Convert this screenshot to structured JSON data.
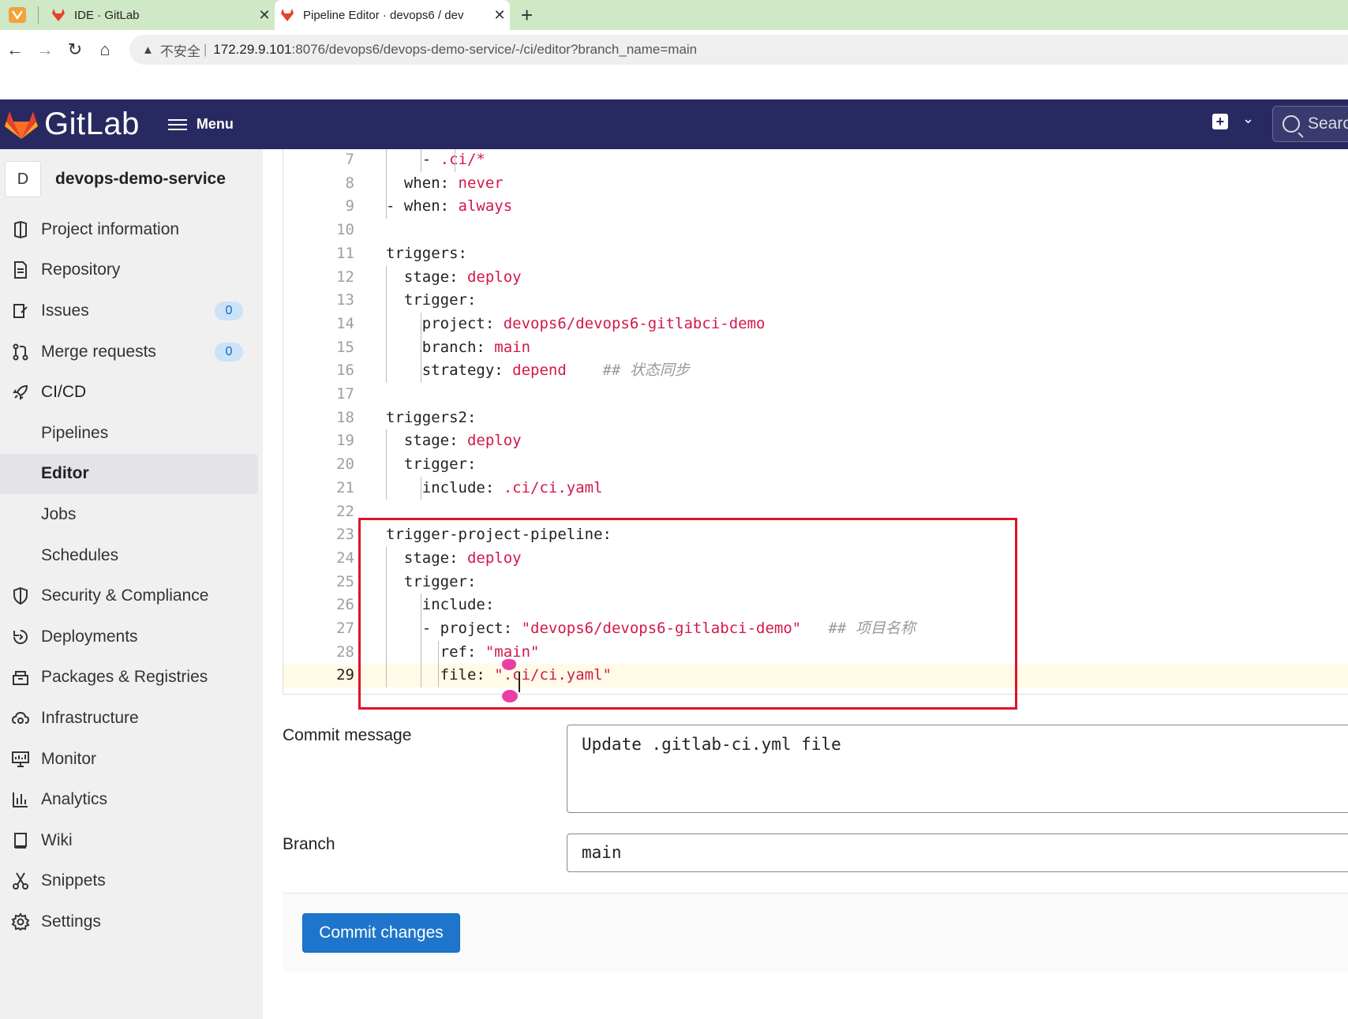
{
  "browser": {
    "tabs": [
      {
        "title": "IDE · GitLab"
      },
      {
        "title": "Pipeline Editor · devops6 / dev"
      }
    ],
    "security_label": "不安全",
    "url_host": "172.29.9.101",
    "url_path": ":8076/devops6/devops-demo-service/-/ci/editor?branch_name=main"
  },
  "gitlab": {
    "brand": "GitLab",
    "menu_label": "Menu",
    "search_placeholder": "Searc"
  },
  "sidebar": {
    "project_avatar": "D",
    "project_name": "devops-demo-service",
    "items": [
      {
        "label": "Project information",
        "icon": "project-info-icon"
      },
      {
        "label": "Repository",
        "icon": "repository-icon"
      },
      {
        "label": "Issues",
        "icon": "issues-icon",
        "badge": "0"
      },
      {
        "label": "Merge requests",
        "icon": "merge-request-icon",
        "badge": "0"
      },
      {
        "label": "CI/CD",
        "icon": "rocket-icon"
      },
      {
        "label": "Pipelines"
      },
      {
        "label": "Editor"
      },
      {
        "label": "Jobs"
      },
      {
        "label": "Schedules"
      },
      {
        "label": "Security & Compliance",
        "icon": "shield-icon"
      },
      {
        "label": "Deployments",
        "icon": "deployments-icon"
      },
      {
        "label": "Packages & Registries",
        "icon": "package-icon"
      },
      {
        "label": "Infrastructure",
        "icon": "cloud-gear-icon"
      },
      {
        "label": "Monitor",
        "icon": "monitor-icon"
      },
      {
        "label": "Analytics",
        "icon": "chart-icon"
      },
      {
        "label": "Wiki",
        "icon": "book-icon"
      },
      {
        "label": "Snippets",
        "icon": "scissors-icon"
      },
      {
        "label": "Settings",
        "icon": "gear-icon"
      }
    ]
  },
  "editor": {
    "current_line": "29",
    "lines": [
      {
        "n": "7",
        "t": [
          [
            "k",
            "    - "
          ],
          [
            "v",
            ".ci/*"
          ]
        ]
      },
      {
        "n": "8",
        "t": [
          [
            "k",
            "  when: "
          ],
          [
            "v",
            "never"
          ]
        ]
      },
      {
        "n": "9",
        "t": [
          [
            "k",
            "- when: "
          ],
          [
            "v",
            "always"
          ]
        ]
      },
      {
        "n": "10",
        "t": []
      },
      {
        "n": "11",
        "t": [
          [
            "k",
            "triggers:"
          ]
        ]
      },
      {
        "n": "12",
        "t": [
          [
            "k",
            "  stage: "
          ],
          [
            "v",
            "deploy"
          ]
        ]
      },
      {
        "n": "13",
        "t": [
          [
            "k",
            "  trigger:"
          ]
        ]
      },
      {
        "n": "14",
        "t": [
          [
            "k",
            "    project: "
          ],
          [
            "v",
            "devops6/devops6-gitlabci-demo"
          ]
        ]
      },
      {
        "n": "15",
        "t": [
          [
            "k",
            "    branch: "
          ],
          [
            "v",
            "main"
          ]
        ]
      },
      {
        "n": "16",
        "t": [
          [
            "k",
            "    strategy: "
          ],
          [
            "v",
            "depend"
          ],
          [
            "cm",
            "    ## 状态同步"
          ]
        ]
      },
      {
        "n": "17",
        "t": []
      },
      {
        "n": "18",
        "t": [
          [
            "k",
            "triggers2:"
          ]
        ]
      },
      {
        "n": "19",
        "t": [
          [
            "k",
            "  stage: "
          ],
          [
            "v",
            "deploy"
          ]
        ]
      },
      {
        "n": "20",
        "t": [
          [
            "k",
            "  trigger:"
          ]
        ]
      },
      {
        "n": "21",
        "t": [
          [
            "k",
            "    include: "
          ],
          [
            "v",
            ".ci/ci.yaml"
          ]
        ]
      },
      {
        "n": "22",
        "t": []
      },
      {
        "n": "23",
        "t": [
          [
            "k",
            "trigger-project-pipeline:"
          ]
        ]
      },
      {
        "n": "24",
        "t": [
          [
            "k",
            "  stage: "
          ],
          [
            "v",
            "deploy"
          ]
        ]
      },
      {
        "n": "25",
        "t": [
          [
            "k",
            "  trigger:"
          ]
        ]
      },
      {
        "n": "26",
        "t": [
          [
            "k",
            "    include:"
          ]
        ]
      },
      {
        "n": "27",
        "t": [
          [
            "k",
            "    - project: "
          ],
          [
            "v",
            "\"devops6/devops6-gitlabci-demo\""
          ],
          [
            "cm",
            "   ## 项目名称"
          ]
        ]
      },
      {
        "n": "28",
        "t": [
          [
            "k",
            "      ref: "
          ],
          [
            "v",
            "\"main\""
          ]
        ]
      },
      {
        "n": "29",
        "t": [
          [
            "k",
            "      file: "
          ],
          [
            "v",
            "\".ci/ci.yaml\""
          ]
        ]
      }
    ]
  },
  "form": {
    "commit_label": "Commit message",
    "commit_value": "Update .gitlab-ci.yml file",
    "branch_label": "Branch",
    "branch_value": "main",
    "submit_label": "Commit changes"
  },
  "colors": {
    "navbar": "#292961",
    "highlight_box": "#e0112b",
    "primary_button": "#1f75cb",
    "yaml_value": "#d3184a"
  }
}
